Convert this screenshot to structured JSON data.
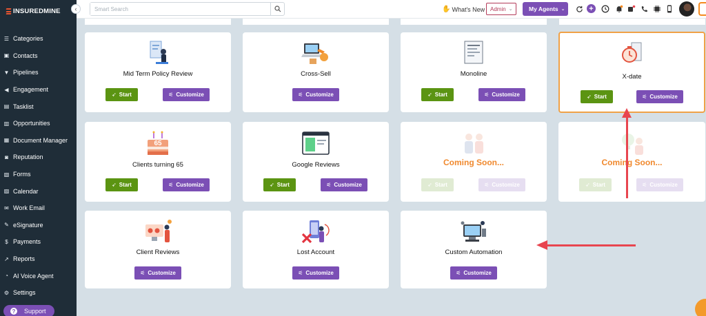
{
  "brand": {
    "name": "INSUREDMINE",
    "accent": "#e8542f"
  },
  "sidebar": {
    "items": [
      {
        "label": "Categories",
        "icon": "list-icon",
        "glyph": "☰"
      },
      {
        "label": "Contacts",
        "icon": "contact-card-icon",
        "glyph": "▣"
      },
      {
        "label": "Pipelines",
        "icon": "filter-icon",
        "glyph": "▼"
      },
      {
        "label": "Engagement",
        "icon": "megaphone-icon",
        "glyph": "◀"
      },
      {
        "label": "Tasklist",
        "icon": "clipboard-icon",
        "glyph": "▤"
      },
      {
        "label": "Opportunities",
        "icon": "bar-chart-icon",
        "glyph": "▥"
      },
      {
        "label": "Document Manager",
        "icon": "folder-icon",
        "glyph": "▦"
      },
      {
        "label": "Reputation",
        "icon": "reputation-icon",
        "glyph": "◙"
      },
      {
        "label": "Forms",
        "icon": "form-icon",
        "glyph": "▧"
      },
      {
        "label": "Calendar",
        "icon": "calendar-icon",
        "glyph": "▨"
      },
      {
        "label": "Work Email",
        "icon": "mail-icon",
        "glyph": "✉"
      },
      {
        "label": "eSignature",
        "icon": "signature-icon",
        "glyph": "✎"
      },
      {
        "label": "Payments",
        "icon": "payment-icon",
        "glyph": "$"
      },
      {
        "label": "Reports",
        "icon": "line-chart-icon",
        "glyph": "↗"
      },
      {
        "label": "AI Voice Agent",
        "icon": "voice-agent-icon",
        "glyph": "◔"
      },
      {
        "label": "Settings",
        "icon": "gear-icon",
        "glyph": "⚙"
      }
    ],
    "support_label": "Support"
  },
  "topbar": {
    "search_placeholder": "Smart Search",
    "whats_new": "What's New",
    "admin_label": "Admin",
    "my_agents_label": "My Agents"
  },
  "buttons": {
    "start": "Start",
    "customize": "Customize"
  },
  "cards": [
    {
      "title": "Mid Term Policy Review"
    },
    {
      "title": "Cross-Sell"
    },
    {
      "title": "Monoline"
    },
    {
      "title": "X-date"
    },
    {
      "title": "Clients turning 65",
      "badge": "65"
    },
    {
      "title": "Google Reviews"
    },
    {
      "title": "Coming Soon..."
    },
    {
      "title": "Coming Soon..."
    },
    {
      "title": "Client Reviews"
    },
    {
      "title": "Lost Account"
    },
    {
      "title": "Custom Automation"
    }
  ],
  "colors": {
    "start": "#5b9412",
    "customize": "#7b4fb5",
    "coming_soon": "#f0892e",
    "annotation_arrow": "#e8454f"
  }
}
